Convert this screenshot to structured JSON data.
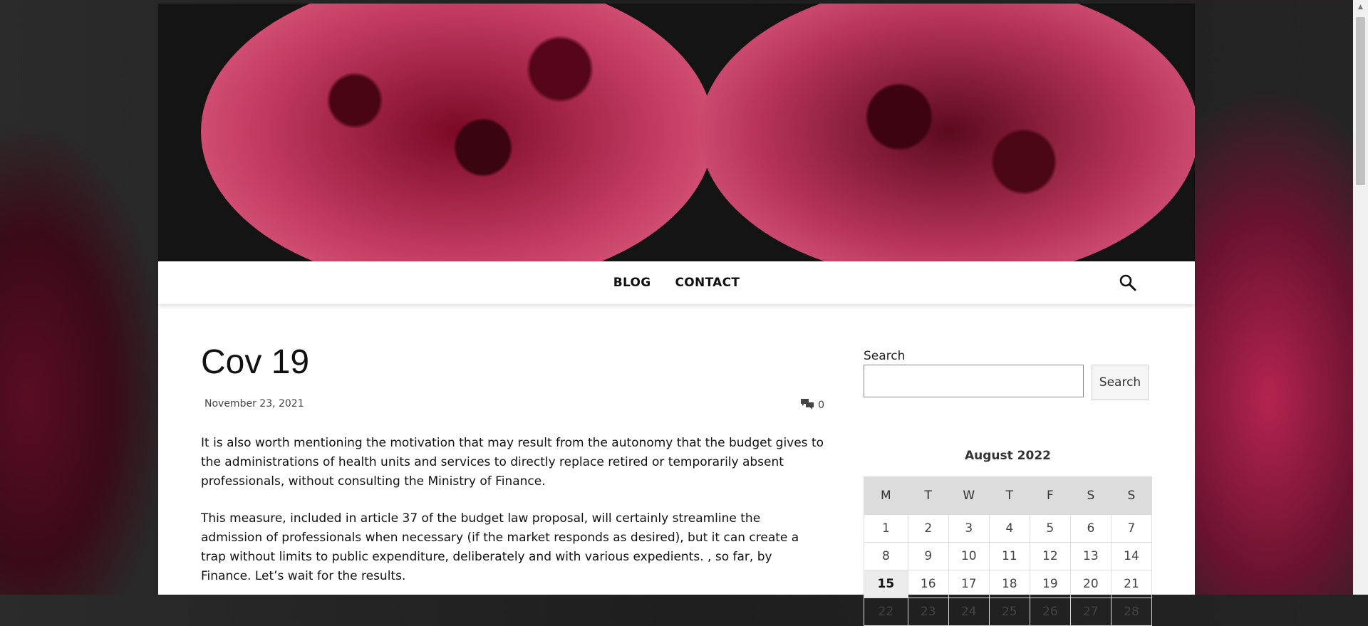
{
  "nav": {
    "links": [
      {
        "label": "BLOG"
      },
      {
        "label": "CONTACT"
      }
    ],
    "search_icon": "search-icon"
  },
  "post": {
    "title": "Cov 19",
    "date": "November 23, 2021",
    "comment_icon": "comments-icon",
    "comment_count": "0",
    "paragraphs": [
      "It is also worth mentioning the motivation that may result from the autonomy that the budget gives to the administrations of health units and services to directly replace retired or temporarily absent professionals, without consulting the Ministry of Finance.",
      "This measure, included in article 37 of the budget law proposal, will certainly streamline the admission of professionals when necessary (if the market responds as desired), but it can create a trap without limits to public expenditure, deliberately and with various expedients. , so far, by Finance. Let’s wait for the results."
    ]
  },
  "sidebar": {
    "search": {
      "label": "Search",
      "placeholder": "",
      "button_label": "Search"
    },
    "calendar": {
      "caption": "August 2022",
      "weekdays": [
        "M",
        "T",
        "W",
        "T",
        "F",
        "S",
        "S"
      ],
      "today": "15",
      "weeks": [
        [
          "1",
          "2",
          "3",
          "4",
          "5",
          "6",
          "7"
        ],
        [
          "8",
          "9",
          "10",
          "11",
          "12",
          "13",
          "14"
        ],
        [
          "15",
          "16",
          "17",
          "18",
          "19",
          "20",
          "21"
        ],
        [
          "22",
          "23",
          "24",
          "25",
          "26",
          "27",
          "28"
        ]
      ]
    }
  },
  "colors": {
    "accent": "#b8345b",
    "text": "#111111",
    "calendar_header_bg": "#dcdcdc"
  }
}
